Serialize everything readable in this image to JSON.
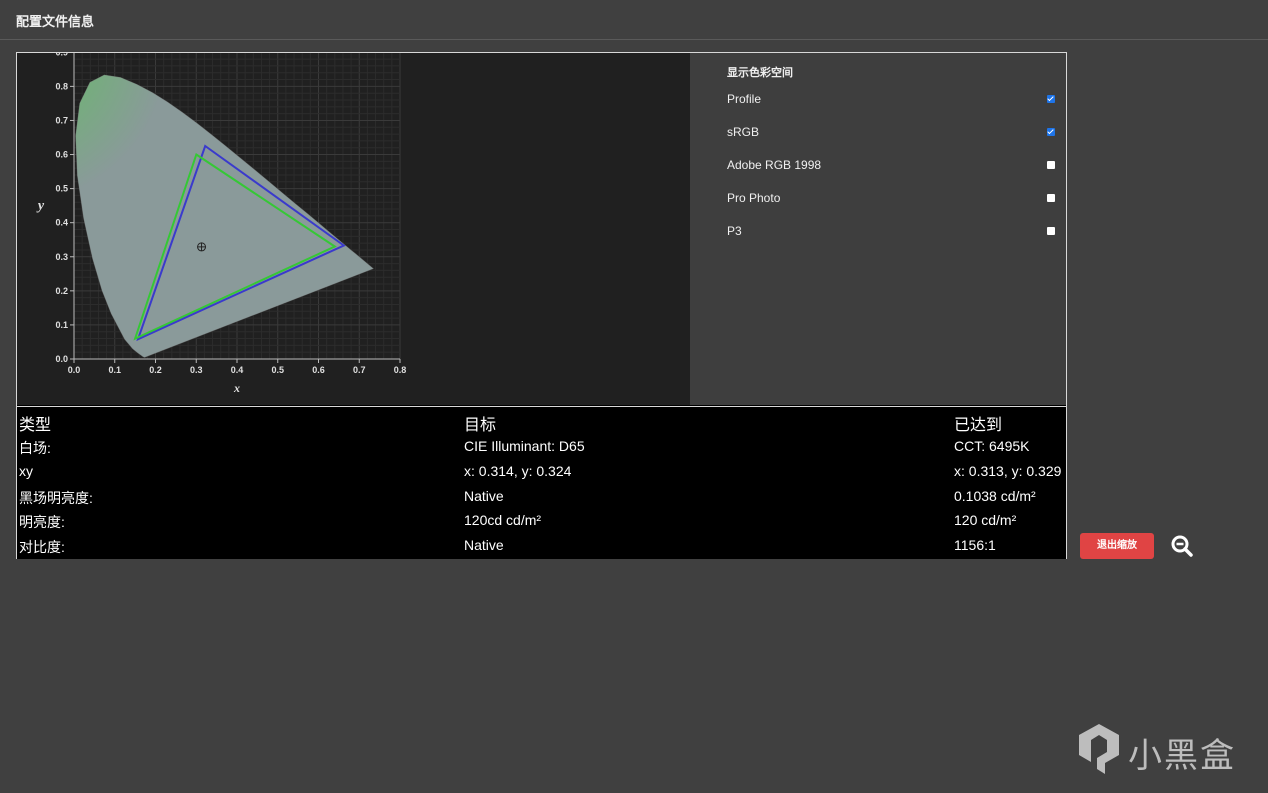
{
  "header": {
    "title": "配置文件信息"
  },
  "chart": {
    "x_axis_label": "x",
    "y_axis_label": "y",
    "x_ticks": [
      "0.0",
      "0.1",
      "0.2",
      "0.3",
      "0.4",
      "0.5",
      "0.6",
      "0.7",
      "0.8"
    ],
    "y_ticks": [
      "0.0",
      "0.1",
      "0.2",
      "0.3",
      "0.4",
      "0.5",
      "0.6",
      "0.7",
      "0.8",
      "0.9"
    ],
    "profile_color": "#3a3acc",
    "srgb_color": "#35c835"
  },
  "chart_data": {
    "type": "scatter",
    "xlabel": "x",
    "ylabel": "y",
    "xlim": [
      0,
      0.8
    ],
    "ylim": [
      0,
      0.9
    ],
    "grid": true,
    "series": [
      {
        "name": "Profile",
        "points": [
          [
            0.322,
            0.625
          ],
          [
            0.662,
            0.333
          ],
          [
            0.157,
            0.058
          ]
        ]
      },
      {
        "name": "sRGB",
        "points": [
          [
            0.3,
            0.6
          ],
          [
            0.64,
            0.33
          ],
          [
            0.15,
            0.06
          ]
        ]
      }
    ],
    "white_point": [
      0.313,
      0.329
    ]
  },
  "options": {
    "title": "显示色彩空间",
    "items": [
      {
        "label": "Profile",
        "checked": true
      },
      {
        "label": "sRGB",
        "checked": true
      },
      {
        "label": "Adobe RGB 1998",
        "checked": false
      },
      {
        "label": "Pro Photo",
        "checked": false
      },
      {
        "label": "P3",
        "checked": false
      }
    ]
  },
  "table": {
    "headers": [
      "类型",
      "目标",
      "已达到"
    ],
    "rows": [
      [
        "白场:",
        "CIE Illuminant: D65",
        "CCT: 6495K"
      ],
      [
        "xy",
        "x: 0.314, y: 0.324",
        "x: 0.313, y: 0.329"
      ],
      [
        "黑场明亮度:",
        "Native",
        "0.1038 cd/m²"
      ],
      [
        "明亮度:",
        "120cd cd/m²",
        "120 cd/m²"
      ],
      [
        "对比度:",
        "Native",
        "1156:1"
      ]
    ]
  },
  "controls": {
    "exit_zoom_label": "退出缩放",
    "zoom_icon": "zoom-out-icon"
  },
  "watermark": {
    "text": "小黑盒"
  }
}
